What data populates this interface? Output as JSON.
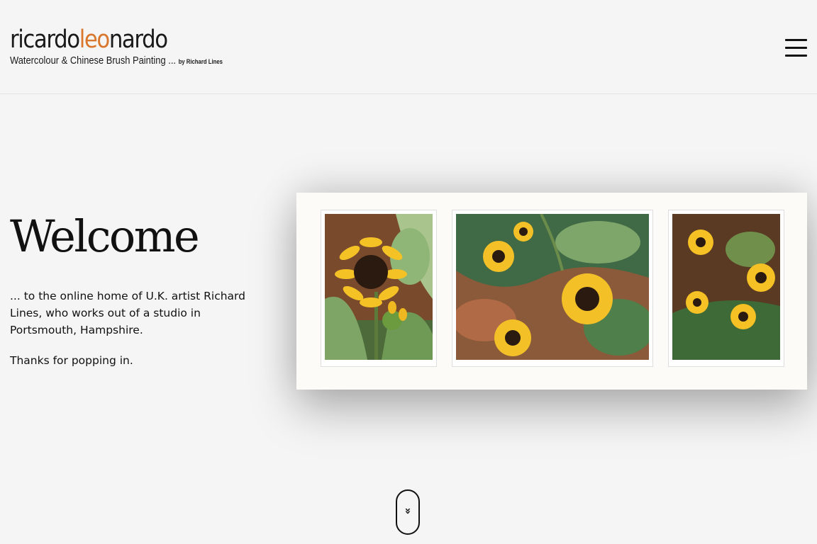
{
  "header": {
    "logo": {
      "part1": "ricardo",
      "part2": "leo",
      "part3": "nardo",
      "tagline": "Watercolour & Chinese Brush Painting ...",
      "byline": "by Richard Lines"
    },
    "menu_icon": "hamburger-menu-icon"
  },
  "hero": {
    "title": "Welcome",
    "intro": "... to the online home of U.K. artist Richard Lines, who works out of a studio in Portsmouth, Hampshire.",
    "thanks": "Thanks for popping in."
  },
  "scroll_indicator": {
    "glyph": "»",
    "icon": "double-chevron-down-icon"
  },
  "colors": {
    "accent": "#d9772e",
    "background": "#f5f5f5",
    "text": "#111111"
  }
}
